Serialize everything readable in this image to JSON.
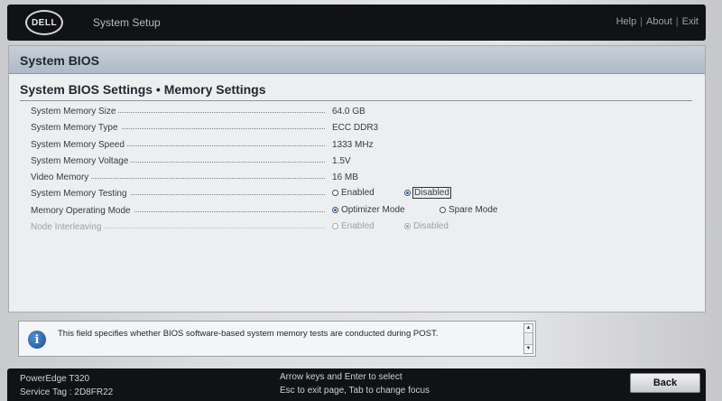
{
  "header": {
    "logo_text": "DELL",
    "app_title": "System Setup",
    "links": [
      "Help",
      "About",
      "Exit"
    ]
  },
  "panel": {
    "title": "System BIOS",
    "subtitle": "System BIOS Settings • Memory Settings"
  },
  "settings": [
    {
      "label": "System Memory Size",
      "value": "64.0 GB"
    },
    {
      "label": "System Memory Type",
      "value": "ECC DDR3"
    },
    {
      "label": "System Memory Speed",
      "value": "1333 MHz"
    },
    {
      "label": "System Memory Voltage",
      "value": "1.5V"
    },
    {
      "label": "Video Memory",
      "value": "16 MB"
    },
    {
      "label": "System Memory Testing",
      "options": [
        "Enabled",
        "Disabled"
      ],
      "selected": "Disabled"
    },
    {
      "label": "Memory Operating Mode",
      "options": [
        "Optimizer Mode",
        "Spare Mode"
      ],
      "selected": "Optimizer Mode"
    },
    {
      "label": "Node Interleaving",
      "options": [
        "Enabled",
        "Disabled"
      ],
      "selected": "Disabled",
      "disabled": true
    }
  ],
  "help": {
    "text": "This field specifies whether BIOS software-based system memory tests are conducted during POST."
  },
  "footer": {
    "model": "PowerEdge T320",
    "service_tag": "Service Tag : 2D8FR22",
    "hint_line1": "Arrow keys and Enter to select",
    "hint_line2": "Esc to exit page, Tab to change focus",
    "back_label": "Back"
  },
  "colors": {
    "header_bg": "#101215",
    "panel_head": "#aebac6",
    "radio_selected": "#2a64b3"
  }
}
